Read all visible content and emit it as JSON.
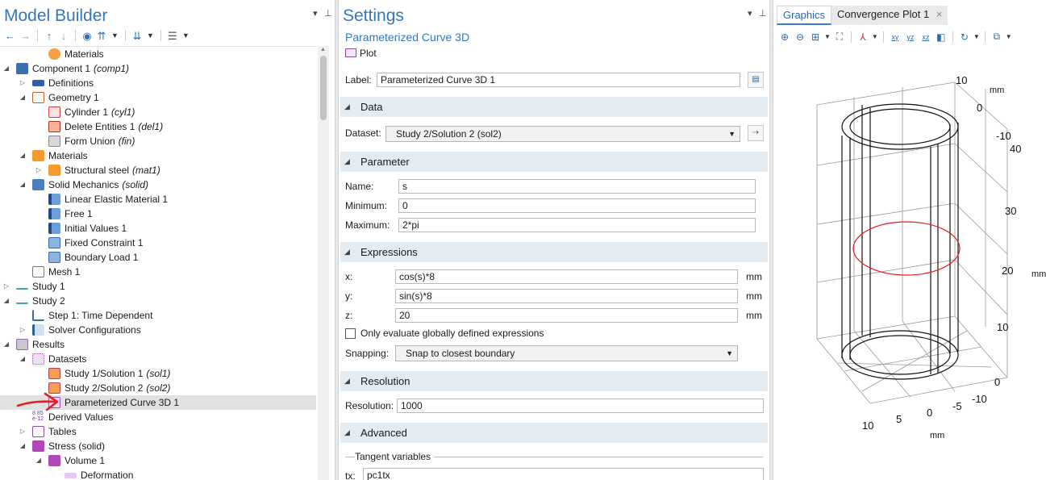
{
  "model_builder": {
    "title": "Model Builder",
    "toolbar": [
      "arrow-left-icon",
      "arrow-right-icon",
      "arrow-up-icon",
      "arrow-down-icon",
      "eye-icon",
      "expand-icon",
      "collapse-icon",
      "list-icon"
    ],
    "tree": [
      {
        "label": "Materials",
        "tag": "",
        "indent": 3,
        "icon": "globe",
        "expander": "none"
      },
      {
        "label": "Component 1",
        "tag": "(comp1)",
        "indent": 1,
        "icon": "component",
        "expander": "open"
      },
      {
        "label": "Definitions",
        "tag": "",
        "indent": 2,
        "icon": "definitions",
        "expander": "closed"
      },
      {
        "label": "Geometry 1",
        "tag": "",
        "indent": 2,
        "icon": "geometry",
        "expander": "open"
      },
      {
        "label": "Cylinder 1",
        "tag": "(cyl1)",
        "indent": 3,
        "icon": "cylinder",
        "expander": "none"
      },
      {
        "label": "Delete Entities 1",
        "tag": "(del1)",
        "indent": 3,
        "icon": "delete",
        "expander": "none"
      },
      {
        "label": "Form Union",
        "tag": "(fin)",
        "indent": 3,
        "icon": "union",
        "expander": "none"
      },
      {
        "label": "Materials",
        "tag": "",
        "indent": 2,
        "icon": "materials",
        "expander": "open"
      },
      {
        "label": "Structural steel",
        "tag": "(mat1)",
        "indent": 3,
        "icon": "materials",
        "expander": "closed"
      },
      {
        "label": "Solid Mechanics",
        "tag": "(solid)",
        "indent": 2,
        "icon": "solid",
        "expander": "open"
      },
      {
        "label": "Linear Elastic Material 1",
        "tag": "",
        "indent": 3,
        "icon": "domain-d",
        "expander": "none"
      },
      {
        "label": "Free 1",
        "tag": "",
        "indent": 3,
        "icon": "domain-d",
        "expander": "none"
      },
      {
        "label": "Initial Values 1",
        "tag": "",
        "indent": 3,
        "icon": "domain-d",
        "expander": "none"
      },
      {
        "label": "Fixed Constraint 1",
        "tag": "",
        "indent": 3,
        "icon": "boundary",
        "expander": "none"
      },
      {
        "label": "Boundary Load 1",
        "tag": "",
        "indent": 3,
        "icon": "boundary",
        "expander": "none"
      },
      {
        "label": "Mesh 1",
        "tag": "",
        "indent": 2,
        "icon": "mesh",
        "expander": "none"
      },
      {
        "label": "Study 1",
        "tag": "",
        "indent": 1,
        "icon": "study",
        "expander": "closed"
      },
      {
        "label": "Study 2",
        "tag": "",
        "indent": 1,
        "icon": "study",
        "expander": "open"
      },
      {
        "label": "Step 1: Time Dependent",
        "tag": "",
        "indent": 2,
        "icon": "time",
        "expander": "none"
      },
      {
        "label": "Solver Configurations",
        "tag": "",
        "indent": 2,
        "icon": "solver",
        "expander": "closed"
      },
      {
        "label": "Results",
        "tag": "",
        "indent": 1,
        "icon": "results",
        "expander": "open"
      },
      {
        "label": "Datasets",
        "tag": "",
        "indent": 2,
        "icon": "datasets",
        "expander": "open"
      },
      {
        "label": "Study 1/Solution 1",
        "tag": "(sol1)",
        "indent": 3,
        "icon": "solution",
        "expander": "none"
      },
      {
        "label": "Study 2/Solution 2",
        "tag": "(sol2)",
        "indent": 3,
        "icon": "solution",
        "expander": "none"
      },
      {
        "label": "Parameterized Curve 3D 1",
        "tag": "",
        "indent": 3,
        "icon": "curve",
        "expander": "none",
        "selected": true
      },
      {
        "label": "Derived Values",
        "tag": "",
        "indent": 2,
        "icon": "derived",
        "expander": "none"
      },
      {
        "label": "Tables",
        "tag": "",
        "indent": 2,
        "icon": "tables",
        "expander": "closed"
      },
      {
        "label": "Stress (solid)",
        "tag": "",
        "indent": 2,
        "icon": "stress",
        "expander": "open"
      },
      {
        "label": "Volume 1",
        "tag": "",
        "indent": 3,
        "icon": "stress",
        "expander": "open"
      },
      {
        "label": "Deformation",
        "tag": "",
        "indent": 4,
        "icon": "deformation",
        "expander": "none"
      }
    ],
    "derived_icon_text": [
      "8.85",
      "e-12"
    ]
  },
  "settings": {
    "title": "Settings",
    "subtitle": "Parameterized Curve 3D",
    "plot_label": "Plot",
    "label_caption": "Label:",
    "label_value": "Parameterized Curve 3D 1",
    "sections": {
      "data": "Data",
      "parameter": "Parameter",
      "expressions": "Expressions",
      "resolution": "Resolution",
      "advanced": "Advanced"
    },
    "dataset_caption": "Dataset:",
    "dataset_value": "Study 2/Solution 2 (sol2)",
    "name_caption": "Name:",
    "name_value": "s",
    "min_caption": "Minimum:",
    "min_value": "0",
    "max_caption": "Maximum:",
    "max_value": "2*pi",
    "x_caption": "x:",
    "x_value": "cos(s)*8",
    "y_caption": "y:",
    "y_value": "sin(s)*8",
    "z_caption": "z:",
    "z_value": "20",
    "unit": "mm",
    "only_global_label": "Only evaluate globally defined expressions",
    "only_global_checked": false,
    "snapping_caption": "Snapping:",
    "snapping_value": "Snap to closest boundary",
    "resolution_caption": "Resolution:",
    "resolution_value": "1000",
    "tangent_label": "Tangent variables",
    "tx_caption": "tx:",
    "tx_value": "pc1tx"
  },
  "graphics": {
    "tabs": [
      {
        "label": "Graphics",
        "active": true
      },
      {
        "label": "Convergence Plot 1",
        "active": false,
        "closable": true
      }
    ],
    "toolbar_icons": [
      "zoom-in-icon",
      "zoom-out-icon",
      "zoom-box-icon",
      "zoom-extents-icon",
      "axes-icon",
      "view-xy-icon",
      "view-yz-icon",
      "view-xz-icon",
      "camera-icon",
      "rotate-icon",
      "render-icon"
    ],
    "toolbar_text": {
      "xy": "xy",
      "yz": "yz",
      "xz": "xz"
    },
    "axis": {
      "top_ticks": [
        "10",
        "0",
        "-10"
      ],
      "top_unit": "mm",
      "z_ticks": [
        "40",
        "30",
        "20",
        "10",
        "0"
      ],
      "z_unit": "mm",
      "bottom_ticks": [
        "10",
        "5",
        "0",
        "-5",
        "-10"
      ],
      "bottom_unit": "mm"
    },
    "curve_color": "#e02020"
  },
  "annotation": {
    "color": "#e02020"
  }
}
